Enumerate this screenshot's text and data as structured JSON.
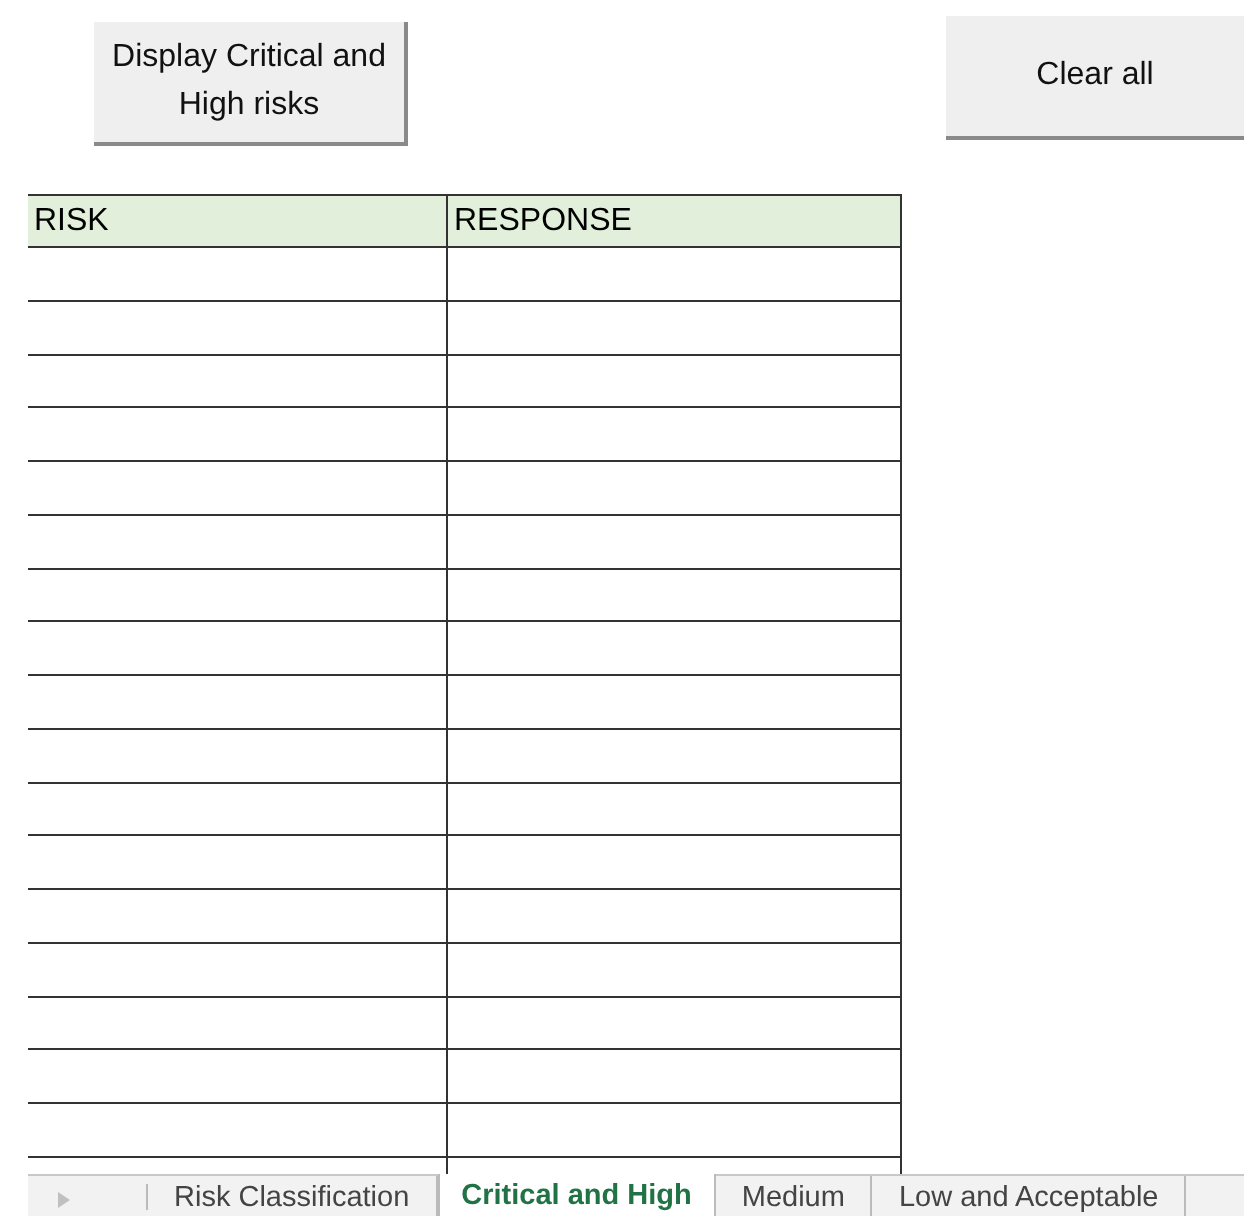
{
  "buttons": [
    {
      "label": "Display Critical and High risks"
    },
    {
      "label": "Clear all"
    }
  ],
  "table": {
    "columns": [
      "RISK",
      "RESPONSE"
    ]
  },
  "sheet_tabs": [
    {
      "label": "Risk Classification",
      "selected": false
    },
    {
      "label": "Critical and High",
      "selected": true
    },
    {
      "label": "Medium",
      "selected": false
    },
    {
      "label": "Low and Acceptable",
      "selected": false
    }
  ]
}
